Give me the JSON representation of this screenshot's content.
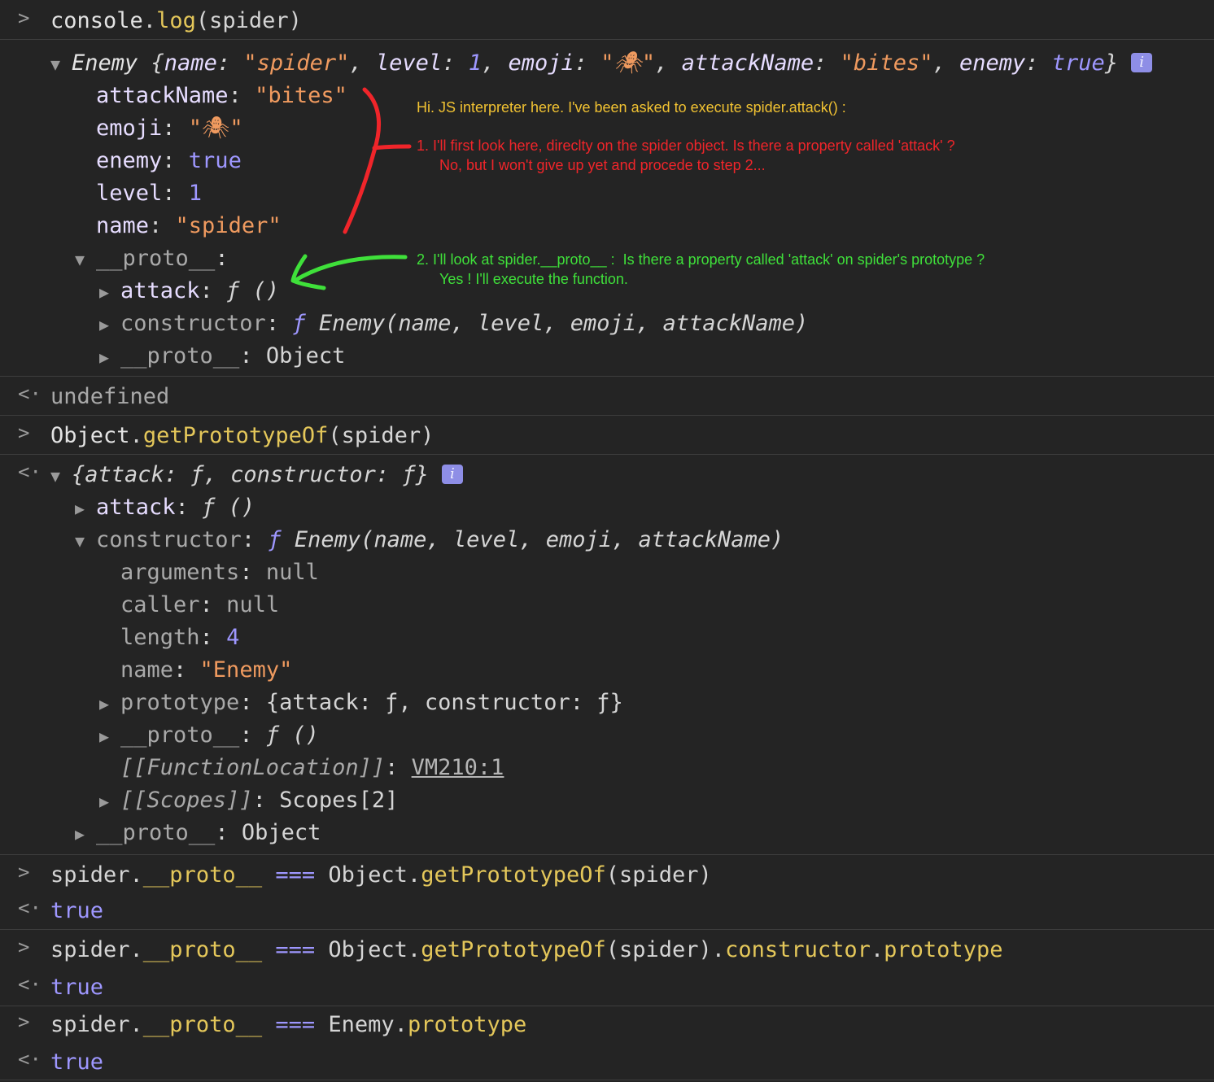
{
  "entry1": {
    "cmd_obj": "console",
    "cmd_method": "log",
    "cmd_args": "(spider)",
    "summary": {
      "class_name": "Enemy",
      "open": " {",
      "name_key": "name",
      "name_val": "\"spider\"",
      "level_key": "level",
      "level_val": "1",
      "emoji_key": "emoji",
      "emoji_val": "\"🕷\"",
      "attack_key": "attackName",
      "attack_val": "\"bites\"",
      "enemy_key": "enemy",
      "enemy_val": "true",
      "close": "}"
    },
    "props": [
      {
        "key": "attackName",
        "val": "\"bites\""
      },
      {
        "key": "emoji",
        "val": "\"🕷\""
      },
      {
        "key": "enemy",
        "val": "true"
      },
      {
        "key": "level",
        "val": "1"
      },
      {
        "key": "name",
        "val": "\"spider\""
      }
    ],
    "proto_key": "__proto__",
    "proto_children": {
      "attack_key": "attack",
      "attack_val": "ƒ ()",
      "ctor_key": "constructor",
      "ctor_f": "ƒ",
      "ctor_sig": "Enemy(name, level, emoji, attackName)",
      "proto_key": "__proto__",
      "proto_val": "Object"
    },
    "result": "undefined"
  },
  "entry2": {
    "cmd_obj": "Object",
    "cmd_method": "getPrototypeOf",
    "cmd_args": "(spider)",
    "summary": "{attack: ƒ, constructor: ƒ}",
    "attack_key": "attack",
    "attack_val": "ƒ ()",
    "ctor_key": "constructor",
    "ctor_f": "ƒ",
    "ctor_sig": "Enemy(name, level, emoji, attackName)",
    "ctor_props": {
      "arguments_key": "arguments",
      "arguments_val": "null",
      "caller_key": "caller",
      "caller_val": "null",
      "length_key": "length",
      "length_val": "4",
      "name_key": "name",
      "name_val": "\"Enemy\"",
      "prototype_key": "prototype",
      "prototype_val": "{attack: ƒ, constructor: ƒ}",
      "proto_key": "__proto__",
      "proto_val": "ƒ ()",
      "location_key": "[[FunctionLocation]]",
      "location_val": "VM210:1",
      "scopes_key": "[[Scopes]]",
      "scopes_val": "Scopes[2]"
    },
    "proto_key": "__proto__",
    "proto_val": "Object"
  },
  "entry3": {
    "lhs_obj": "spider.",
    "lhs_prop": "__proto__",
    "op": " === ",
    "rhs_obj": "Object.",
    "rhs_method": "getPrototypeOf",
    "rhs_args": "(spider)",
    "result": "true"
  },
  "entry4": {
    "lhs_obj": "spider.",
    "lhs_prop": "__proto__",
    "op": " === ",
    "rhs_obj": "Object.",
    "rhs_method": "getPrototypeOf",
    "rhs_args": "(spider).",
    "rhs_p1": "constructor",
    "rhs_dot": ".",
    "rhs_p2": "prototype",
    "result": "true"
  },
  "entry5": {
    "lhs_obj": "spider.",
    "lhs_prop": "__proto__",
    "op": " === ",
    "rhs_obj": "Enemy.",
    "rhs_prop": "prototype",
    "result": "true"
  },
  "annotations": {
    "intro": "Hi. JS interpreter here. I've been asked to execute spider.attack() :",
    "step1_line1": "1. I'll first look here, direclty on the spider object. Is there a property called 'attack' ?",
    "step1_line2": "No, but I won't give up yet and procede to step 2...",
    "step2_line1": "2. I'll look at spider.__proto__ :  Is there a property called 'attack' on spider's prototype ?",
    "step2_line2": "Yes ! I'll execute the function."
  },
  "colors": {
    "background": "#242424",
    "string": "#ef9a5f",
    "number": "#9e97ff",
    "method": "#e4c75a",
    "annotation_yellow": "#f1c232",
    "annotation_red": "#f0252a",
    "annotation_green": "#3fe03a"
  },
  "icons": {
    "prompt": "chevron-right-icon",
    "result": "return-arrow-icon",
    "expanded": "triangle-down-icon",
    "collapsed": "triangle-right-icon",
    "info": "info-icon"
  }
}
